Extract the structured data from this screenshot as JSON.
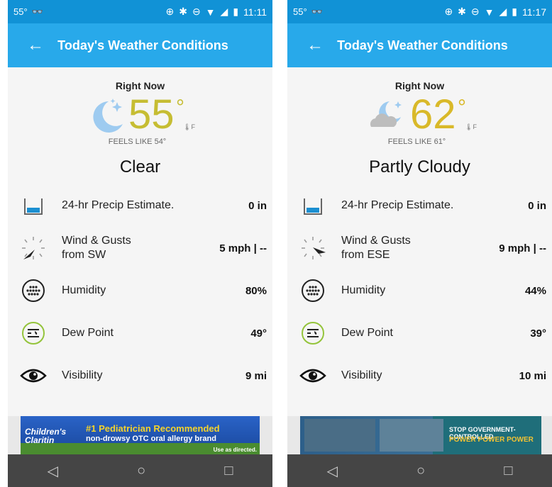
{
  "screens": [
    {
      "status": {
        "temp": "55°",
        "time": "11:11"
      },
      "header": {
        "title": "Today's Weather Conditions"
      },
      "now": {
        "label": "Right Now",
        "temp": "55",
        "unit": "F",
        "feels": "FEELS LIKE 54°",
        "condition": "Clear",
        "icon": "moon-icon"
      },
      "rows": [
        {
          "label": "24-hr Precip Estimate.",
          "value": "0 in",
          "icon": "rain-gauge-icon"
        },
        {
          "label": "Wind & Gusts",
          "sub": "from SW",
          "value": "5 mph | --",
          "icon": "wind-compass-icon"
        },
        {
          "label": "Humidity",
          "value": "80%",
          "icon": "humidity-icon"
        },
        {
          "label": "Dew Point",
          "value": "49°",
          "icon": "dew-point-icon"
        },
        {
          "label": "Visibility",
          "value": "9 mi",
          "icon": "eye-icon"
        }
      ],
      "ad": {
        "brand": "Children's Claritin",
        "headline": "#1 Pediatrician Recommended",
        "subline": "non-drowsy OTC oral allergy brand",
        "note": "Use as directed."
      }
    },
    {
      "status": {
        "temp": "55°",
        "time": "11:17"
      },
      "header": {
        "title": "Today's Weather Conditions"
      },
      "now": {
        "label": "Right Now",
        "temp": "62",
        "unit": "F",
        "feels": "FEELS LIKE 61°",
        "condition": "Partly Cloudy",
        "icon": "moon-cloud-icon"
      },
      "rows": [
        {
          "label": "24-hr Precip Estimate.",
          "value": "0 in",
          "icon": "rain-gauge-icon"
        },
        {
          "label": "Wind & Gusts",
          "sub": "from ESE",
          "value": "9 mph | --",
          "icon": "wind-compass-icon"
        },
        {
          "label": "Humidity",
          "value": "44%",
          "icon": "humidity-icon"
        },
        {
          "label": "Dew Point",
          "value": "39°",
          "icon": "dew-point-icon"
        },
        {
          "label": "Visibility",
          "value": "10 mi",
          "icon": "eye-icon"
        }
      ],
      "ad": {
        "headline": "STOP GOVERNMENT-CONTROLLED",
        "subline": "POWER POWER POWER"
      }
    }
  ],
  "colors": {
    "statusbar": "#1192d6",
    "appbar": "#28a9ea",
    "temp_clear": "#c6bd33",
    "temp_cloudy": "#d9b929",
    "icon_blue": "#1b8fd1",
    "icon_green": "#94c43b"
  }
}
